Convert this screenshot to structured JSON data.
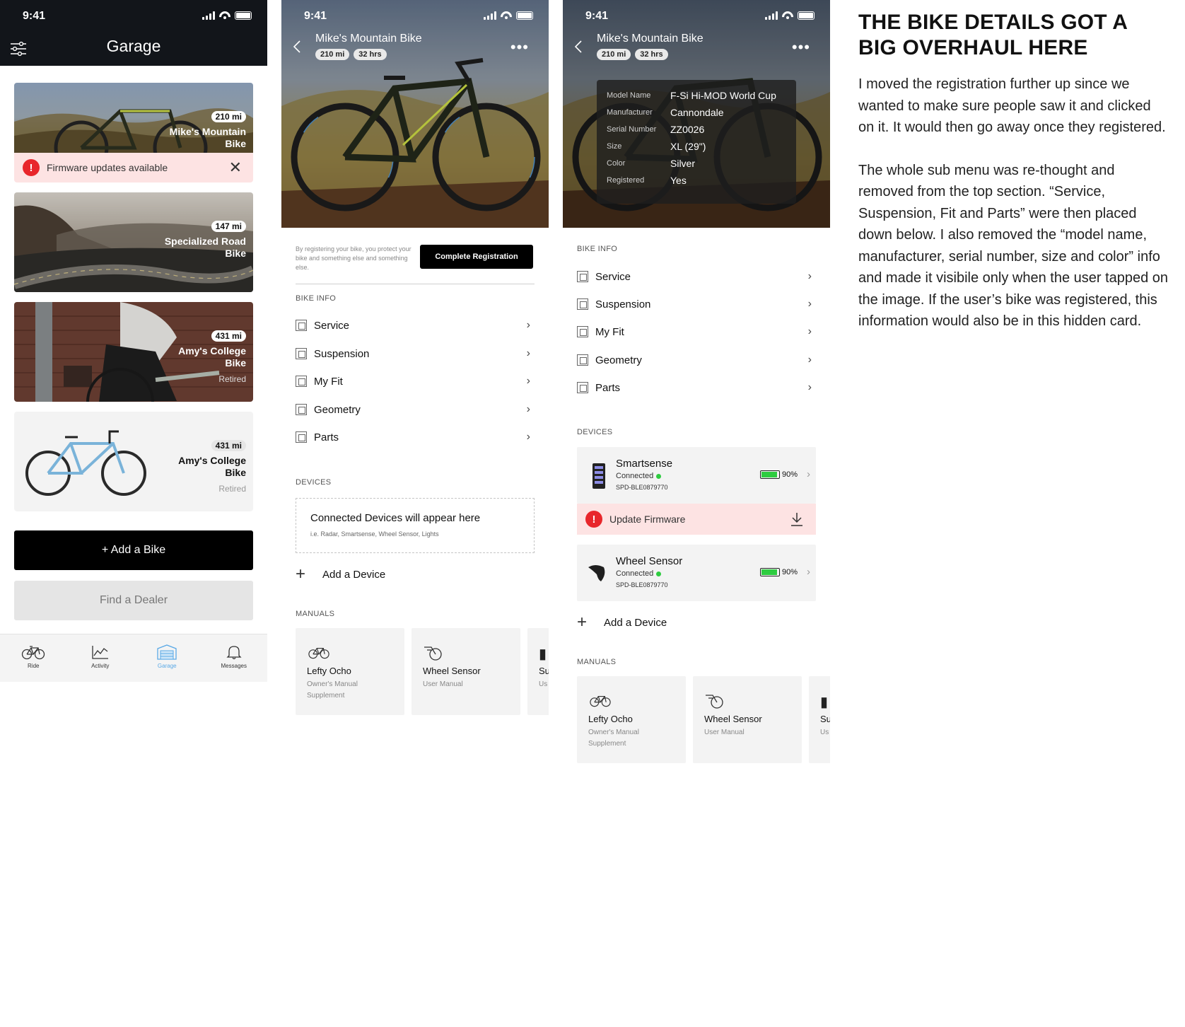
{
  "status": {
    "time": "9:41"
  },
  "garage": {
    "title": "Garage",
    "bikes": [
      {
        "miles": "210 mi",
        "name_line1": "Mike's Mountain",
        "name_line2": "Bike",
        "status": ""
      },
      {
        "miles": "147 mi",
        "name_line1": "Specialized Road",
        "name_line2": "Bike",
        "status": ""
      },
      {
        "miles": "431 mi",
        "name_line1": "Amy's College",
        "name_line2": "Bike",
        "status": "Retired"
      },
      {
        "miles": "431 mi",
        "name_line1": "Amy's College",
        "name_line2": "Bike",
        "status": "Retired"
      }
    ],
    "alert": "Firmware updates available",
    "add_bike": "+ Add a Bike",
    "find_dealer": "Find a Dealer",
    "tabs": [
      {
        "label": "Ride",
        "icon": "bike-icon"
      },
      {
        "label": "Activity",
        "icon": "activity-chart-icon"
      },
      {
        "label": "Garage",
        "icon": "garage-icon",
        "active": true
      },
      {
        "label": "Messages",
        "icon": "bell-icon"
      }
    ]
  },
  "detail": {
    "bike_title": "Mike's Mountain Bike",
    "chips": [
      "210 mi",
      "32 hrs"
    ],
    "registration_note": "By registering your bike, you protect your bike and something else and something else.",
    "registration_button": "Complete Registration",
    "bike_info_header": "BIKE INFO",
    "menu": [
      "Service",
      "Suspension",
      "My Fit",
      "Geometry",
      "Parts"
    ],
    "devices_header": "DEVICES",
    "empty_devices_title": "Connected Devices will appear here",
    "empty_devices_sub": "i.e. Radar, Smartsense, Wheel Sensor, Lights",
    "add_device": "Add a Device",
    "manuals_header": "MANUALS",
    "manuals": [
      {
        "title": "Lefty Ocho",
        "sub": "Owner's Manual Supplement"
      },
      {
        "title": "Wheel Sensor",
        "sub": "User Manual"
      },
      {
        "title": "Su",
        "sub": "Us"
      }
    ]
  },
  "detail_info": {
    "fields": [
      {
        "key": "Model Name",
        "value": "F-Si Hi-MOD World Cup"
      },
      {
        "key": "Manufacturer",
        "value": "Cannondale"
      },
      {
        "key": "Serial Number",
        "value": "ZZ0026"
      },
      {
        "key": "Size",
        "value": "XL (29\")"
      },
      {
        "key": "Color",
        "value": "Silver"
      },
      {
        "key": "Registered",
        "value": "Yes"
      }
    ],
    "devices": [
      {
        "name": "Smartsense",
        "status": "Connected",
        "serial": "SPD-BLE0879770",
        "battery": "90%",
        "battery_level": 0.9
      },
      {
        "name": "Wheel Sensor",
        "status": "Connected",
        "serial": "SPD-BLE0879770",
        "battery": "90%",
        "battery_level": 0.9
      }
    ],
    "update_firmware": "Update Firmware"
  },
  "annotation": {
    "heading": "THE BIKE DETAILS GOT A BIG OVERHAUL HERE",
    "paragraph1": "I moved the registration further up since we wanted to make sure people saw it and clicked on it. It would then go away once they registered.",
    "paragraph2": "The whole sub menu was re-thought and removed from the top section. “Service, Suspension, Fit and Parts” were then placed down below. I also removed the “model name, manufacturer, serial number, size and color” info and made it visibile only when the user tapped on the image. If the user’s bike was registered, this information would also be in this hidden card."
  },
  "colors": {
    "alert_bg": "#fde3e3",
    "alert_red": "#e8262b",
    "active_tab": "#5aa9e6",
    "battery_green": "#2ecc40"
  }
}
